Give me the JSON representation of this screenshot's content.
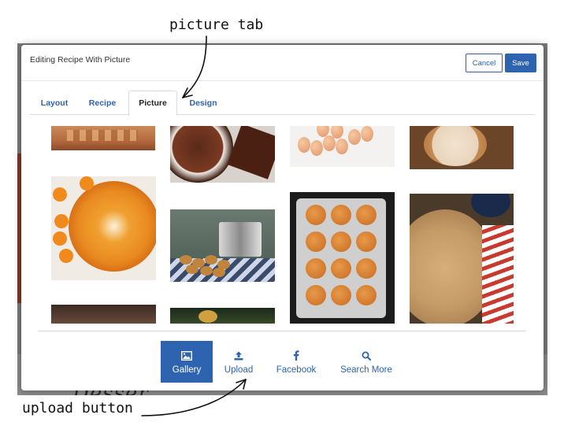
{
  "annotations": {
    "picture_tab": "picture tab",
    "upload_button": "upload button"
  },
  "background": {
    "partial_text": "Desser"
  },
  "modal": {
    "title": "Editing Recipe With Picture",
    "cancel_label": "Cancel",
    "save_label": "Save"
  },
  "tabs": [
    {
      "label": "Layout",
      "active": false
    },
    {
      "label": "Recipe",
      "active": false
    },
    {
      "label": "Picture",
      "active": true
    },
    {
      "label": "Design",
      "active": false
    }
  ],
  "sources": [
    {
      "label": "Gallery",
      "icon": "image-icon",
      "active": true
    },
    {
      "label": "Upload",
      "icon": "upload-icon",
      "active": false
    },
    {
      "label": "Facebook",
      "icon": "facebook-icon",
      "active": false
    },
    {
      "label": "Search More",
      "icon": "search-icon",
      "active": false
    }
  ],
  "colors": {
    "accent": "#2e63b0",
    "backdrop": "#7a7a7a"
  }
}
